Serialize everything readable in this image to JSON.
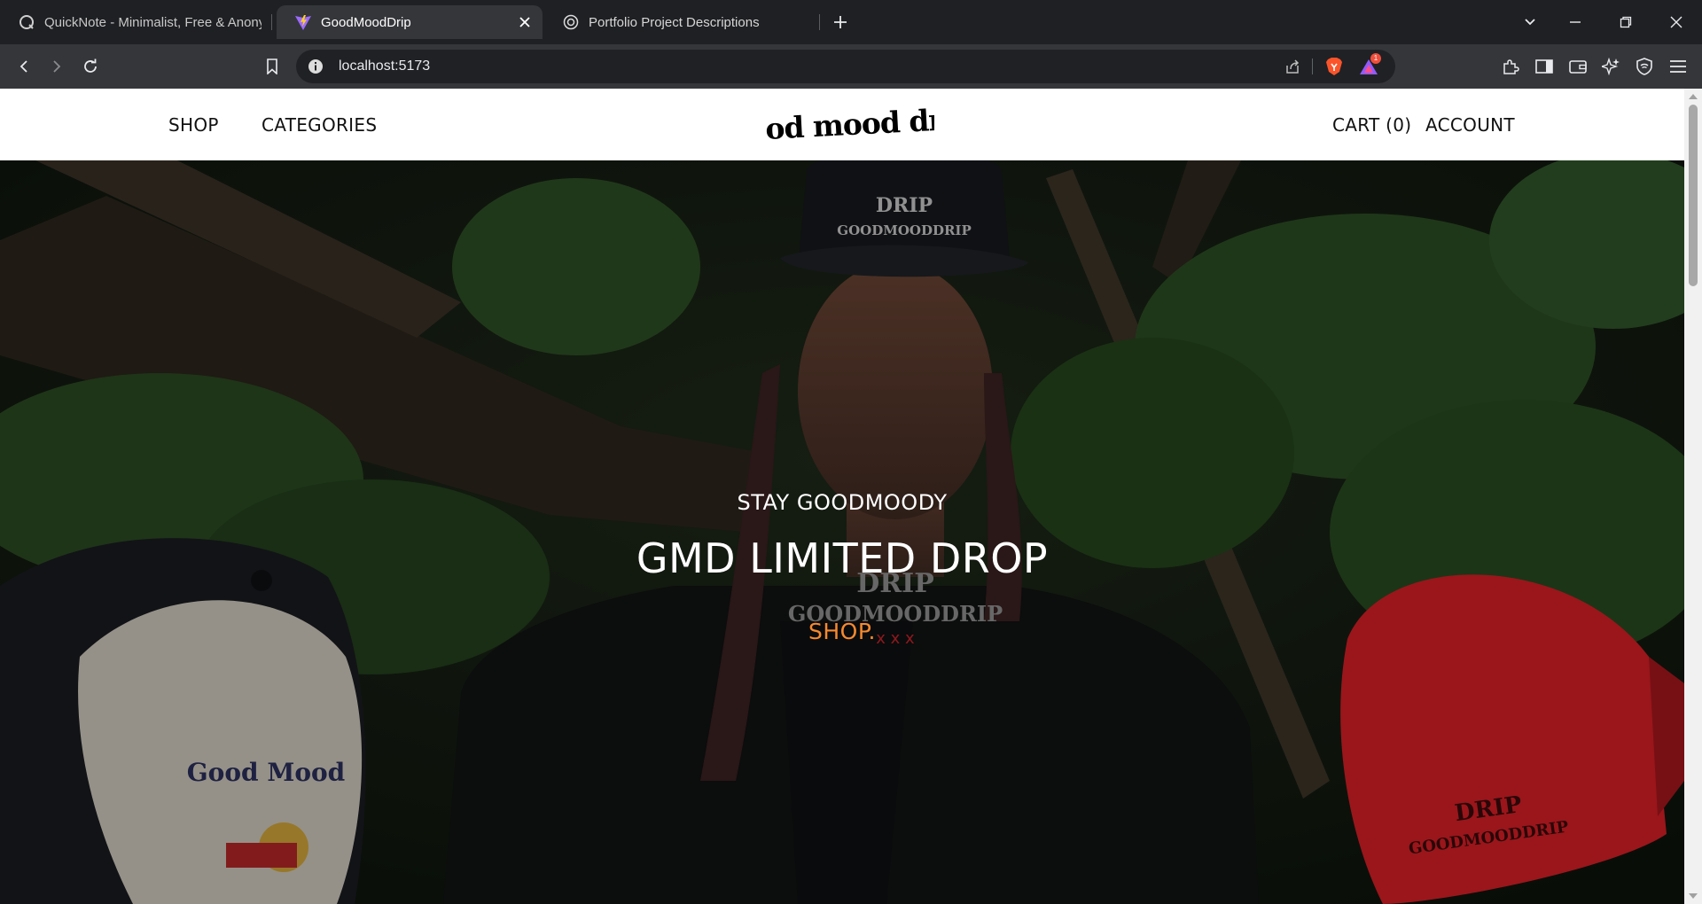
{
  "browser": {
    "tabs": [
      {
        "title": "QuickNote - Minimalist, Free & Anonymous",
        "active": false,
        "icon": "quicknote-icon"
      },
      {
        "title": "GoodMoodDrip",
        "active": true,
        "icon": "vite-icon"
      },
      {
        "title": "Portfolio Project Descriptions",
        "active": false,
        "icon": "openai-icon"
      }
    ],
    "url": "localhost:5173",
    "rewards_badge": "1"
  },
  "site": {
    "nav_left": [
      "SHOP",
      "CATEGORIES"
    ],
    "logo_text": "good mood drip",
    "nav_right": {
      "cart": "CART (0)",
      "account": "ACCOUNT"
    }
  },
  "hero": {
    "subtitle": "STAY GOODMOODY",
    "title": "GMD LIMITED DROP",
    "cta": "SHOP.",
    "cta_color": "#f6892f",
    "left_cap_label": "Good Mood",
    "center_shirt_label": [
      "DRIP",
      "GOODMOODDRIP"
    ],
    "right_cap_label": [
      "DRIP",
      "GOODMOODDRIP"
    ]
  },
  "colors": {
    "chrome_bg": "#1f2023",
    "toolbar_bg": "#35363a",
    "accent_orange": "#f6892f",
    "cap_red": "#d61f26"
  }
}
